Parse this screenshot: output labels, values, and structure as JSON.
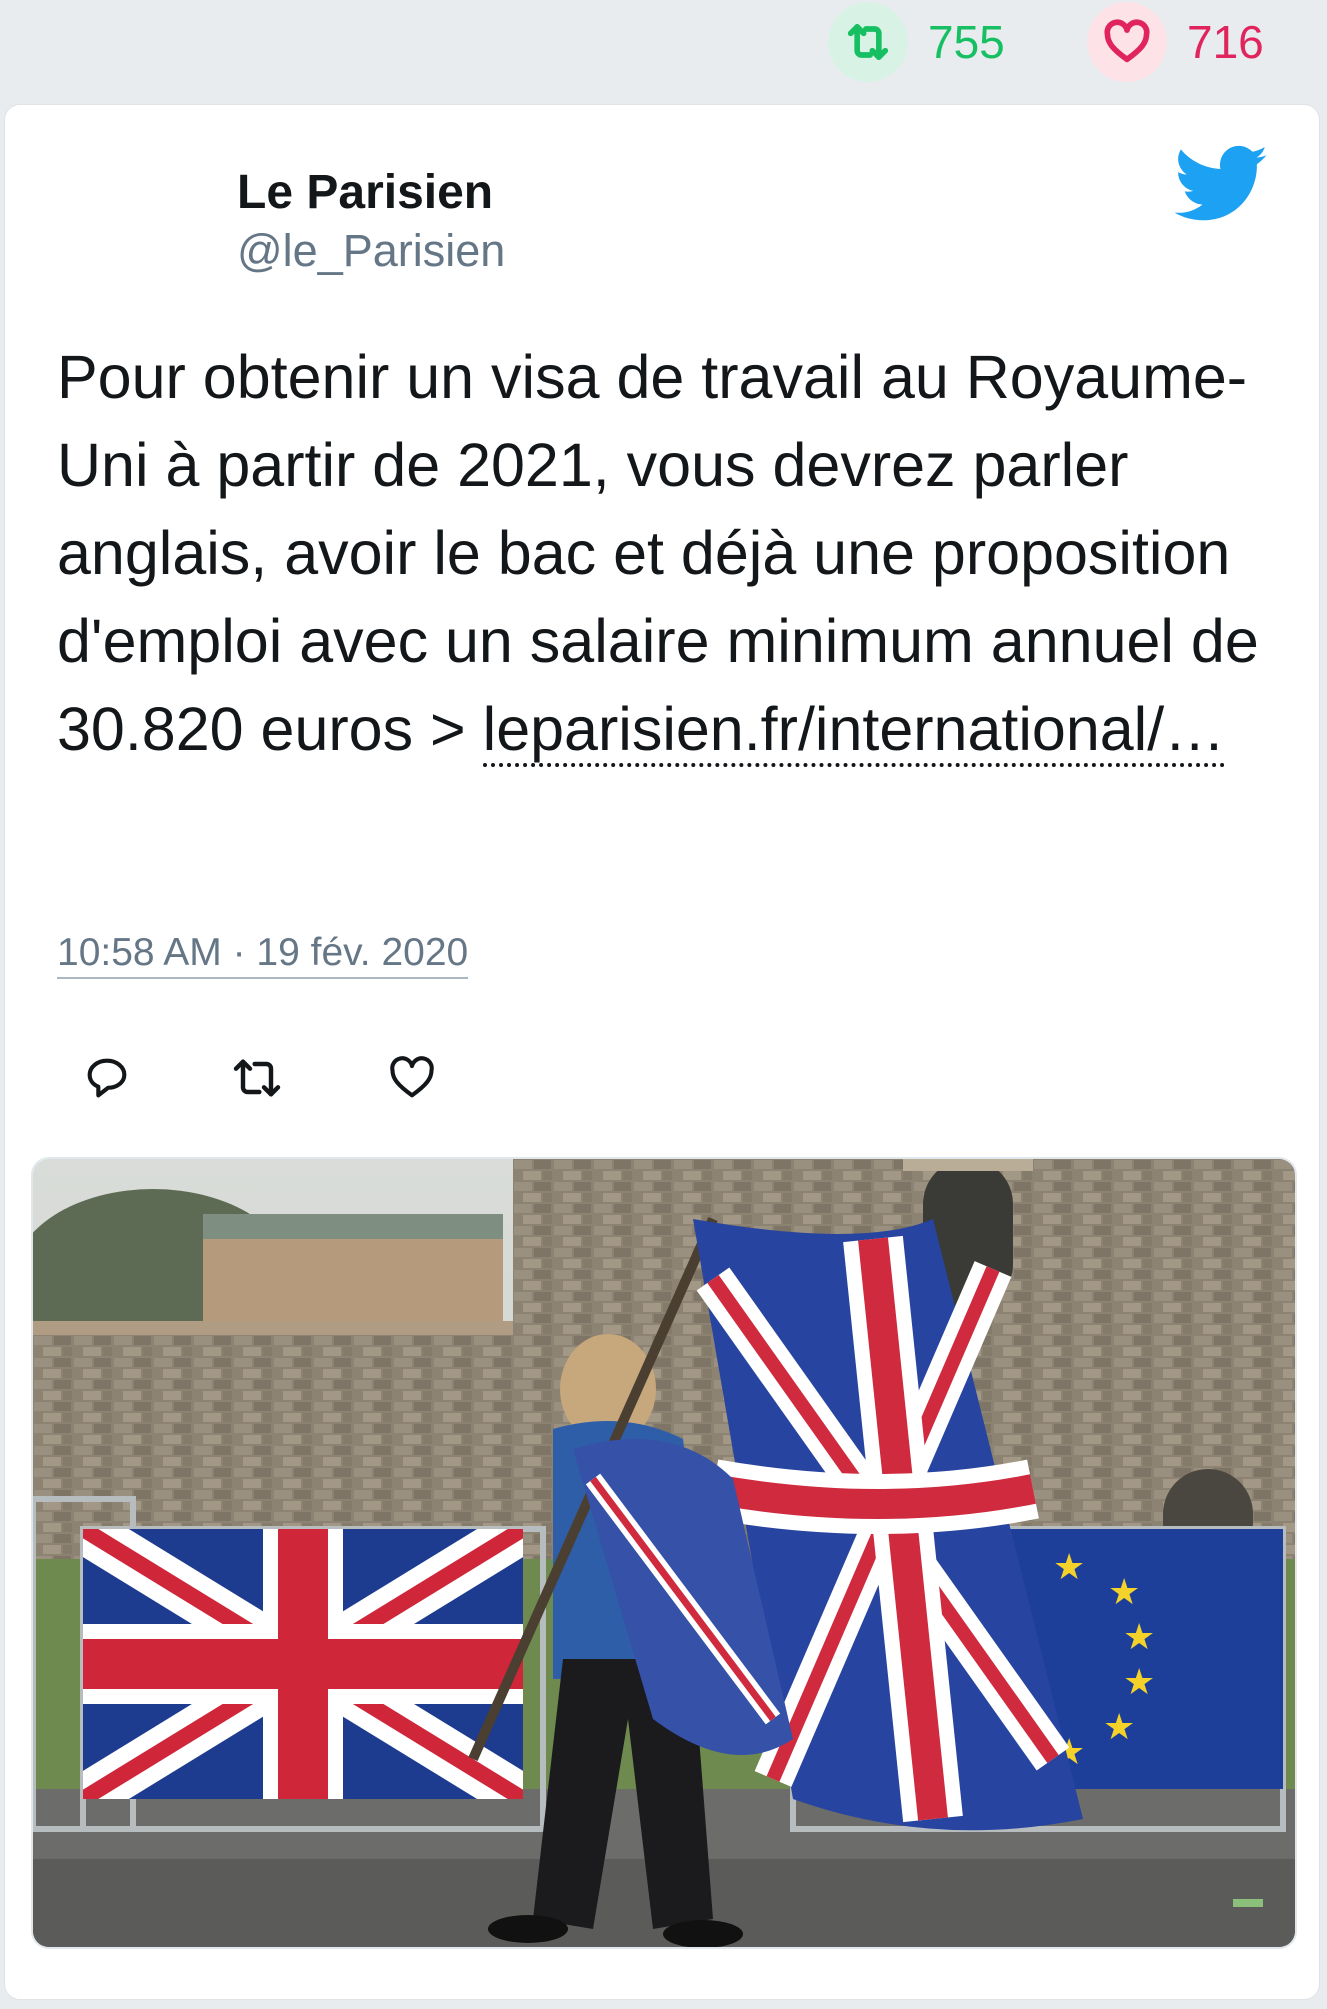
{
  "stats": {
    "retweet_icon": "retweet-icon",
    "retweet_count": "755",
    "like_icon": "heart-icon",
    "like_count": "716"
  },
  "tweet": {
    "author_name": "Le Parisien",
    "author_handle": "@le_Parisien",
    "text": "Pour obtenir un visa de travail au Royaume-Uni à partir de 2021, vous devrez parler anglais, avoir le bac et déjà une proposition d'emploi avec un salaire minimum annuel de 30.820 euros >",
    "link_text": "leparisien.fr/international/…",
    "timestamp": "10:58 AM · 19 fév. 2020",
    "actions": [
      {
        "name": "reply",
        "icon": "reply-icon"
      },
      {
        "name": "retweet",
        "icon": "retweet-icon"
      },
      {
        "name": "like",
        "icon": "heart-icon"
      }
    ],
    "media_description": "photo-union-jack-eu-flags"
  },
  "colors": {
    "retweet_green": "#17bf63",
    "like_red": "#e0245e",
    "twitter_blue": "#1da1f2",
    "secondary_text": "#657786"
  }
}
